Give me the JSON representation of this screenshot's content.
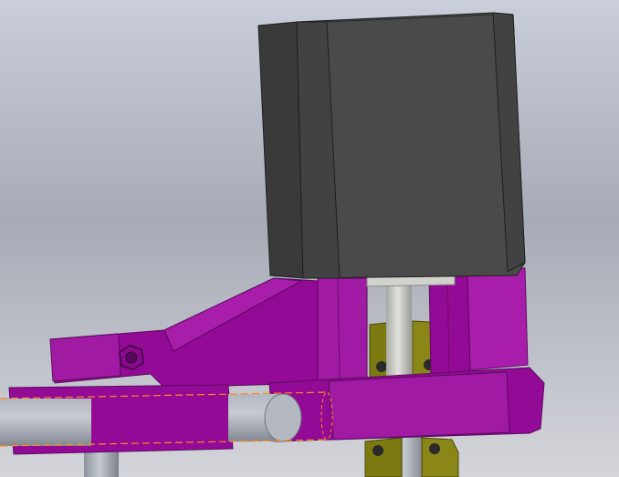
{
  "viewport": {
    "background_top": "#c9ceda",
    "background_mid": "#a7abb6",
    "background_bottom": "#d3d5da"
  },
  "colors": {
    "motor_front": "#4a4a4a",
    "motor_side": "#3a3a3a",
    "motor_edge": "#202020",
    "bracket": "#930a96",
    "bracket_dark": "#6e0a72",
    "bracket_light": "#a81eab",
    "shaft": "#cfcfcb",
    "tube": "#9ea3ad",
    "tube_light": "#c3c7cf",
    "olive": "#7d7a12",
    "olive_light": "#9a9626",
    "highlight": "#ff8a1e"
  },
  "parts": [
    "stepper-motor",
    "motor-bracket",
    "motor-shaft",
    "support-arm",
    "horizontal-tube",
    "coupler-blocks",
    "vertical-rods",
    "hex-nut"
  ]
}
